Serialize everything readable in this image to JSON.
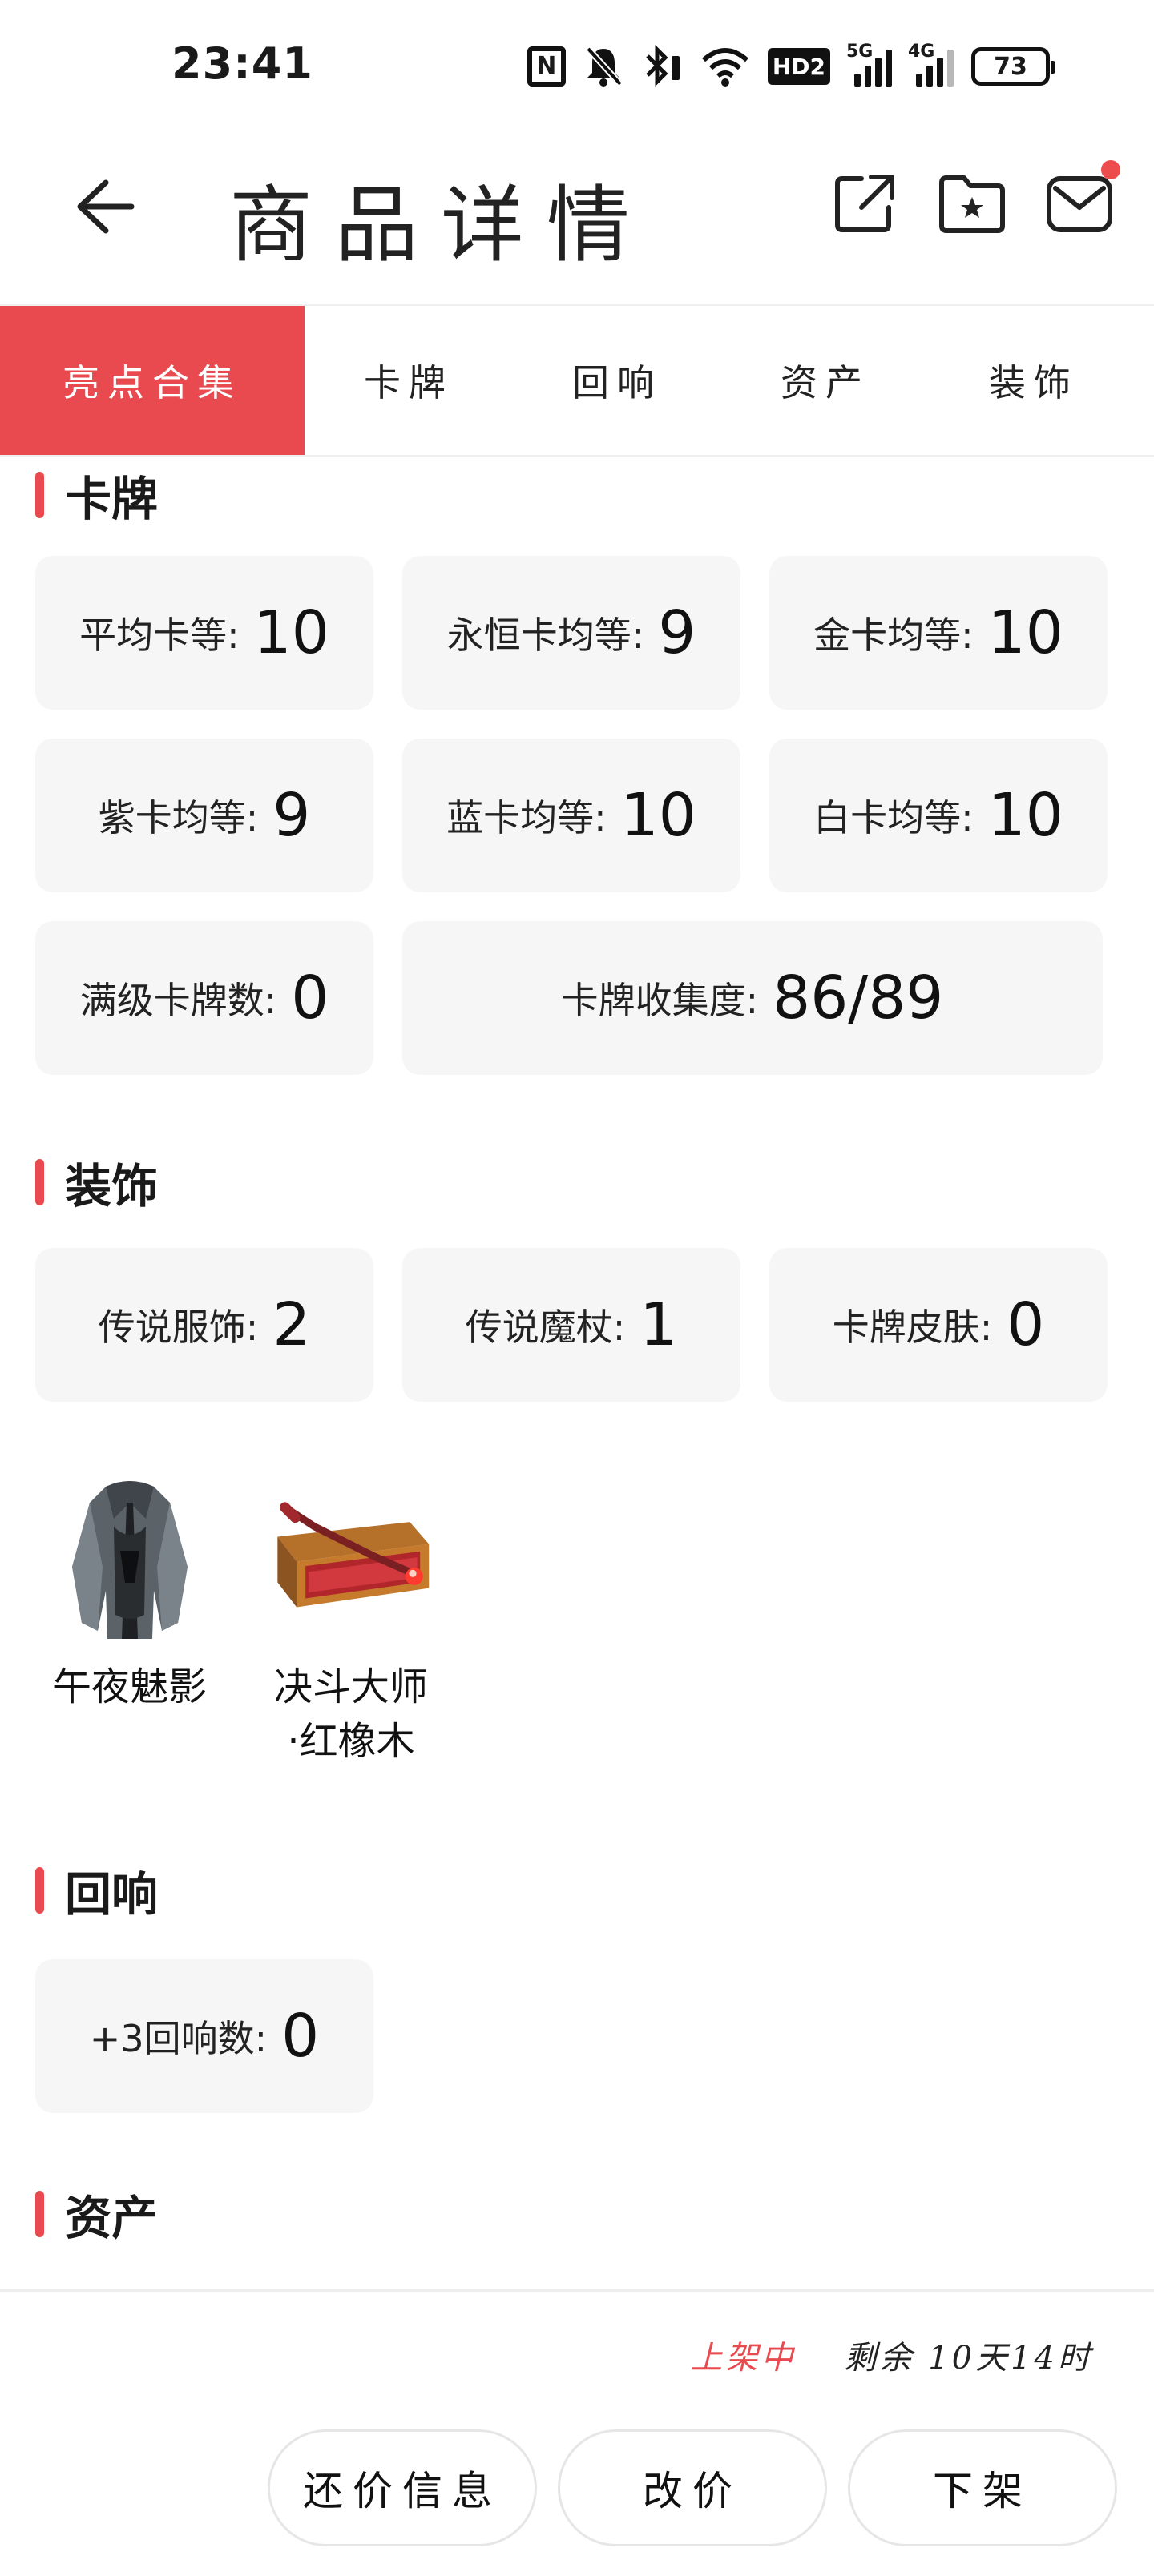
{
  "status_bar": {
    "time": "23:41",
    "nfc": "N",
    "hd": "HD2",
    "signal1_label": "5G",
    "signal2_label": "4G",
    "battery": "73",
    "icons": [
      "nfc-icon",
      "mute-bell-icon",
      "bluetooth-icon",
      "wifi-icon",
      "hd-icon",
      "signal-5g-icon",
      "signal-4g-icon",
      "battery-icon"
    ]
  },
  "header": {
    "title": "商品详情",
    "icons": [
      "back-arrow-icon",
      "share-icon",
      "favorite-folder-icon",
      "message-icon"
    ],
    "has_notification_dot": true
  },
  "tabs": [
    {
      "label": "亮点合集",
      "active": true
    },
    {
      "label": "卡牌",
      "active": false
    },
    {
      "label": "回响",
      "active": false
    },
    {
      "label": "资产",
      "active": false
    },
    {
      "label": "装饰",
      "active": false
    }
  ],
  "sections": {
    "cards": {
      "title": "卡牌",
      "stats": [
        {
          "label": "平均卡等:",
          "value": "10"
        },
        {
          "label": "永恒卡均等:",
          "value": "9"
        },
        {
          "label": "金卡均等:",
          "value": "10"
        },
        {
          "label": "紫卡均等:",
          "value": "9"
        },
        {
          "label": "蓝卡均等:",
          "value": "10"
        },
        {
          "label": "白卡均等:",
          "value": "10"
        },
        {
          "label": "满级卡牌数:",
          "value": "0"
        },
        {
          "label": "卡牌收集度:",
          "value": "86/89"
        }
      ]
    },
    "decor": {
      "title": "装饰",
      "stats": [
        {
          "label": "传说服饰:",
          "value": "2"
        },
        {
          "label": "传说魔杖:",
          "value": "1"
        },
        {
          "label": "卡牌皮肤:",
          "value": "0"
        }
      ],
      "items": [
        {
          "name": "午夜魅影",
          "icon": "robe-icon"
        },
        {
          "name_line1": "决斗大师",
          "name_line2": "·红橡木",
          "icon": "wand-case-icon"
        }
      ]
    },
    "echo": {
      "title": "回响",
      "stats": [
        {
          "label": "+3回响数:",
          "value": "0"
        }
      ]
    },
    "assets": {
      "title": "资产"
    }
  },
  "bottom": {
    "status": "上架中",
    "remaining": "剩余 10天14时",
    "buttons": [
      "还价信息",
      "改价",
      "下架"
    ]
  },
  "colors": {
    "accent": "#e84a4f",
    "card_bg": "#f6f6f6",
    "text": "#1a1a1a"
  }
}
